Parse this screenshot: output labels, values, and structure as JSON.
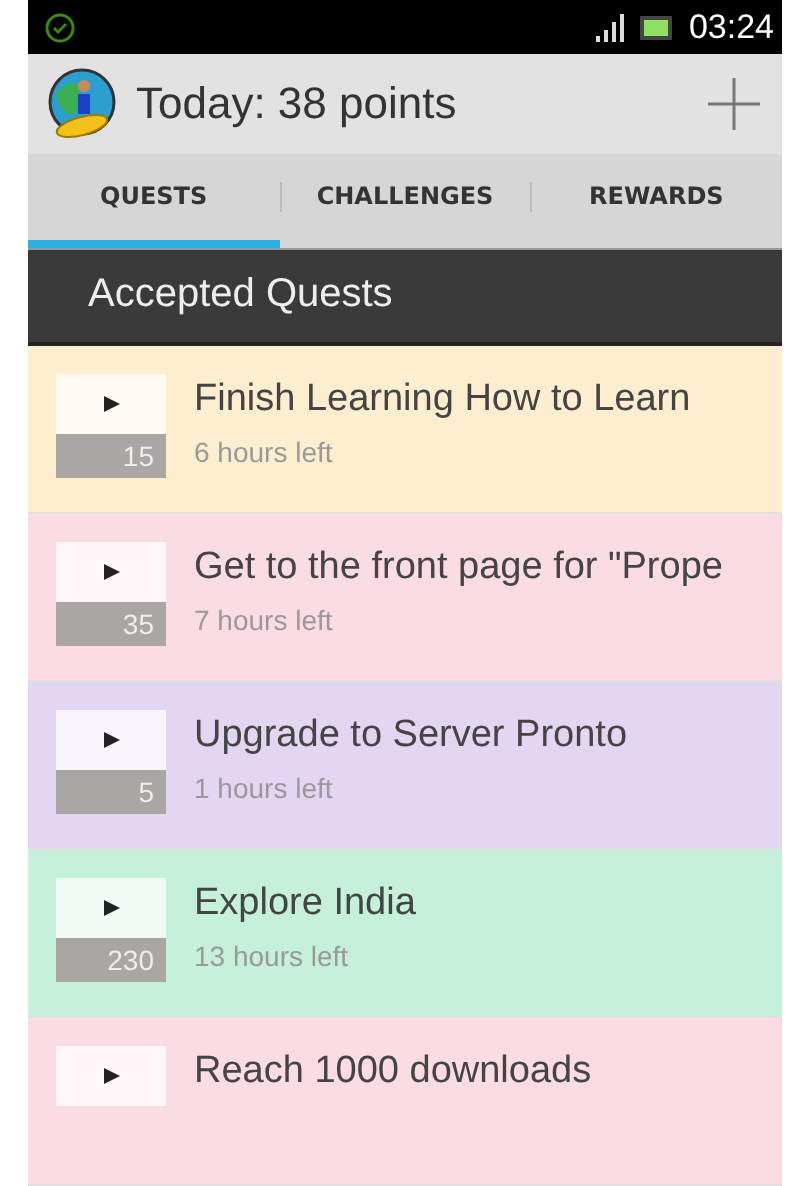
{
  "status_bar": {
    "time": "03:24"
  },
  "app_bar": {
    "title": "Today: 38 points"
  },
  "tabs": [
    {
      "label": "QUESTS",
      "selected": true
    },
    {
      "label": "CHALLENGES",
      "selected": false
    },
    {
      "label": "REWARDS",
      "selected": false
    }
  ],
  "section_header": "Accepted Quests",
  "quests": [
    {
      "title": "Finish Learning How to Learn",
      "points": "15",
      "time_left": "6 hours left",
      "color": "#fdeecf"
    },
    {
      "title": "Get to the front page for \"Prope",
      "points": "35",
      "time_left": "7 hours left",
      "color": "#fbdbe4"
    },
    {
      "title": "Upgrade to Server Pronto",
      "points": "5",
      "time_left": "1 hours left",
      "color": "#e3d6f2"
    },
    {
      "title": "Explore India",
      "points": "230",
      "time_left": "13 hours left",
      "color": "#c4f0dc"
    },
    {
      "title": "Reach 1000 downloads",
      "color": "#fbdbe4"
    }
  ]
}
